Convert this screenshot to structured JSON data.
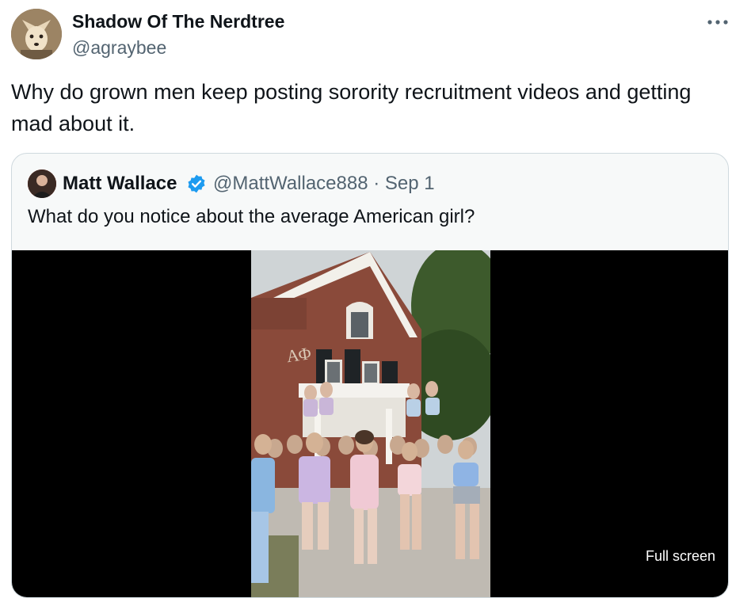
{
  "author": {
    "name": "Shadow Of The Nerdtree",
    "handle": "@agraybee",
    "avatar_icon": "fox-avatar"
  },
  "post": {
    "text": "Why do grown men keep posting sorority recruitment videos and getting mad about it."
  },
  "more_icon": "ellipsis-icon",
  "quoted": {
    "name": "Matt Wallace",
    "verified_icon": "verified-badge-icon",
    "verified_color": "#1d9bf0",
    "handle_date": "@MattWallace888 · Sep 1",
    "text": "What do you notice about the average American girl?",
    "media": {
      "building_sign": "ΑΦ",
      "fullscreen_label": "Full screen"
    }
  },
  "colors": {
    "text": "#0f1419",
    "secondary": "#536471",
    "border": "#cfd9de",
    "brand": "#1d9bf0"
  }
}
